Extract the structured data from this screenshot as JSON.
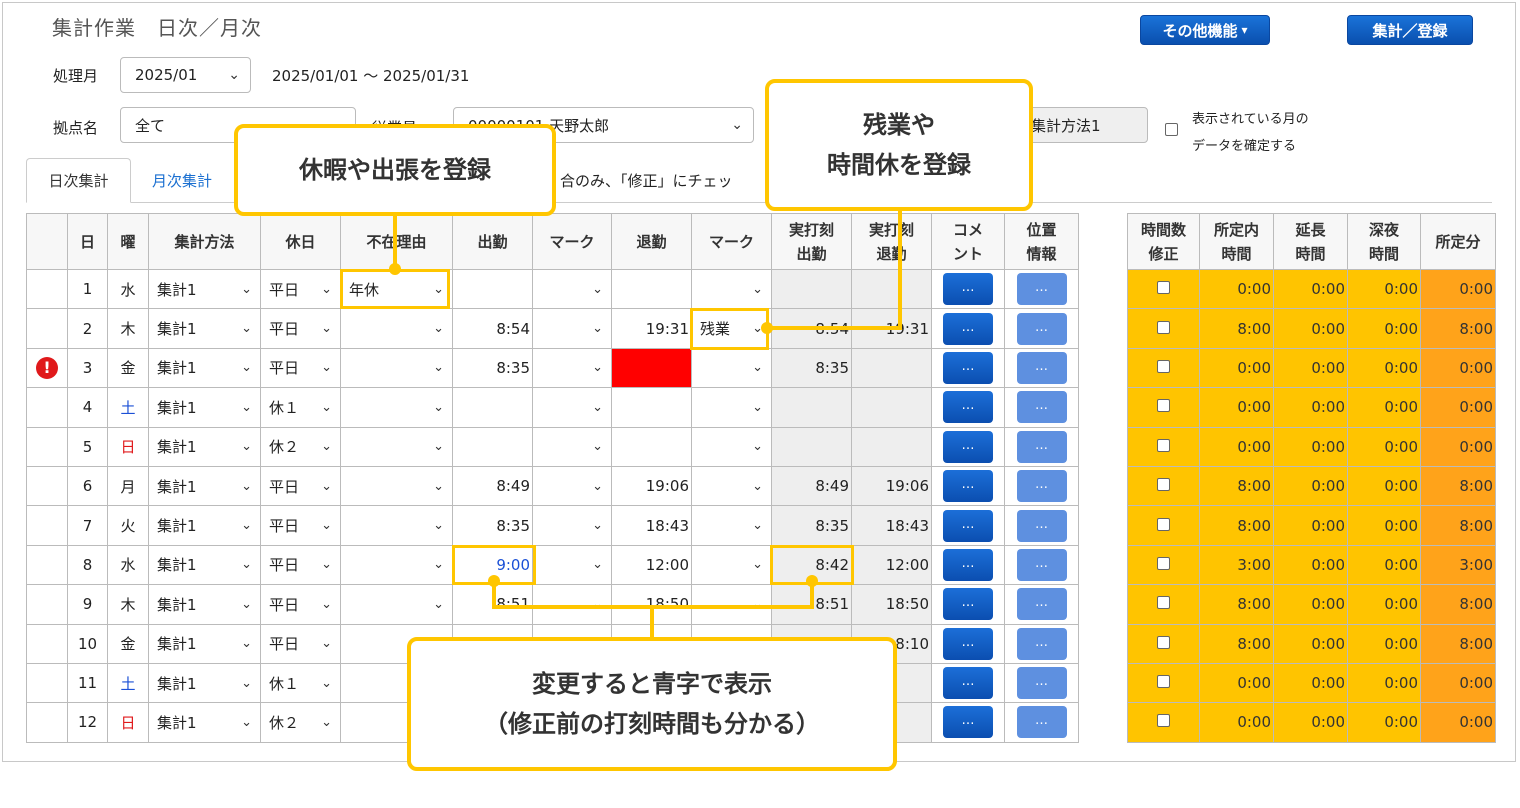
{
  "header": {
    "title": "集計作業　日次／月次",
    "other_functions": "その他機能",
    "other_functions_caret": "▾",
    "register": "集計／登録"
  },
  "filters": {
    "period_label": "処理月",
    "period_value": "2025/01",
    "period_range": "2025/01/01 〜 2025/01/31",
    "site_label": "拠点名",
    "site_value": "全て",
    "employee_label": "従業員",
    "employee_value": "00000101 天野太郎",
    "method_value": "集計方法1",
    "confirm_line1": "表示されている月の",
    "confirm_line2": "データを確定する"
  },
  "tabs": {
    "daily": "日次集計",
    "monthly": "月次集計"
  },
  "notice_text": "合のみ、「修正」にチェッ",
  "table_headers": {
    "day": "日",
    "weekday": "曜",
    "method": "集計方法",
    "holiday": "休日",
    "absence": "不在理由",
    "in": "出勤",
    "mark1": "マーク",
    "out": "退勤",
    "mark2": "マーク",
    "actual_in_1": "実打刻",
    "actual_in_2": "出勤",
    "actual_out_1": "実打刻",
    "actual_out_2": "退勤",
    "comment_1": "コメ",
    "comment_2": "ント",
    "location_1": "位置",
    "location_2": "情報"
  },
  "summary_headers": {
    "hours_fix_1": "時間数",
    "hours_fix_2": "修正",
    "scheduled_1": "所定内",
    "scheduled_2": "時間",
    "extended_1": "延長",
    "extended_2": "時間",
    "night_1": "深夜",
    "night_2": "時間",
    "scheduled_min": "所定分"
  },
  "dots_label": "…",
  "rows": [
    {
      "day": "1",
      "wd": "水",
      "wdc": "",
      "method": "集計1",
      "holiday": "平日",
      "absence": "年休",
      "in": "",
      "mark1": "",
      "out": "",
      "mark2": "",
      "ain": "",
      "aout": "",
      "s1": "0:00",
      "s2": "0:00",
      "s3": "0:00",
      "s4": "0:00"
    },
    {
      "day": "2",
      "wd": "木",
      "wdc": "",
      "method": "集計1",
      "holiday": "平日",
      "absence": "",
      "in": "8:54",
      "mark1": "",
      "out": "19:31",
      "mark2": "残業",
      "ain": "8:54",
      "aout": "19:31",
      "s1": "8:00",
      "s2": "0:00",
      "s3": "0:00",
      "s4": "8:00"
    },
    {
      "day": "3",
      "wd": "金",
      "wdc": "",
      "method": "集計1",
      "holiday": "平日",
      "absence": "",
      "in": "8:35",
      "mark1": "",
      "out": "",
      "mark2": "",
      "ain": "8:35",
      "aout": "",
      "s1": "0:00",
      "s2": "0:00",
      "s3": "0:00",
      "s4": "0:00"
    },
    {
      "day": "4",
      "wd": "土",
      "wdc": "blue",
      "method": "集計1",
      "holiday": "休１",
      "absence": "",
      "in": "",
      "mark1": "",
      "out": "",
      "mark2": "",
      "ain": "",
      "aout": "",
      "s1": "0:00",
      "s2": "0:00",
      "s3": "0:00",
      "s4": "0:00"
    },
    {
      "day": "5",
      "wd": "日",
      "wdc": "red",
      "method": "集計1",
      "holiday": "休２",
      "absence": "",
      "in": "",
      "mark1": "",
      "out": "",
      "mark2": "",
      "ain": "",
      "aout": "",
      "s1": "0:00",
      "s2": "0:00",
      "s3": "0:00",
      "s4": "0:00"
    },
    {
      "day": "6",
      "wd": "月",
      "wdc": "",
      "method": "集計1",
      "holiday": "平日",
      "absence": "",
      "in": "8:49",
      "mark1": "",
      "out": "19:06",
      "mark2": "",
      "ain": "8:49",
      "aout": "19:06",
      "s1": "8:00",
      "s2": "0:00",
      "s3": "0:00",
      "s4": "8:00"
    },
    {
      "day": "7",
      "wd": "火",
      "wdc": "",
      "method": "集計1",
      "holiday": "平日",
      "absence": "",
      "in": "8:35",
      "mark1": "",
      "out": "18:43",
      "mark2": "",
      "ain": "8:35",
      "aout": "18:43",
      "s1": "8:00",
      "s2": "0:00",
      "s3": "0:00",
      "s4": "8:00"
    },
    {
      "day": "8",
      "wd": "水",
      "wdc": "",
      "method": "集計1",
      "holiday": "平日",
      "absence": "",
      "in": "9:00",
      "mark1": "",
      "out": "12:00",
      "mark2": "",
      "ain": "8:42",
      "aout": "12:00",
      "s1": "3:00",
      "s2": "0:00",
      "s3": "0:00",
      "s4": "3:00"
    },
    {
      "day": "9",
      "wd": "木",
      "wdc": "",
      "method": "集計1",
      "holiday": "平日",
      "absence": "",
      "in": "8:51",
      "mark1": "",
      "out": "18:50",
      "mark2": "",
      "ain": "8:51",
      "aout": "18:50",
      "s1": "8:00",
      "s2": "0:00",
      "s3": "0:00",
      "s4": "8:00"
    },
    {
      "day": "10",
      "wd": "金",
      "wdc": "",
      "method": "集計1",
      "holiday": "平日",
      "absence": "",
      "in": "",
      "mark1": "",
      "out": "",
      "mark2": "",
      "ain": "",
      "aout": "18:10",
      "s1": "8:00",
      "s2": "0:00",
      "s3": "0:00",
      "s4": "8:00"
    },
    {
      "day": "11",
      "wd": "土",
      "wdc": "blue",
      "method": "集計1",
      "holiday": "休１",
      "absence": "",
      "in": "",
      "mark1": "",
      "out": "",
      "mark2": "",
      "ain": "",
      "aout": "",
      "s1": "0:00",
      "s2": "0:00",
      "s3": "0:00",
      "s4": "0:00"
    },
    {
      "day": "12",
      "wd": "日",
      "wdc": "red",
      "method": "集計1",
      "holiday": "休２",
      "absence": "",
      "in": "",
      "mark1": "",
      "out": "",
      "mark2": "",
      "ain": "",
      "aout": "",
      "s1": "0:00",
      "s2": "0:00",
      "s3": "0:00",
      "s4": "0:00"
    }
  ],
  "callouts": {
    "absence": "休暇や出張を登録",
    "overtime_1": "残業や",
    "overtime_2": "時間休を登録",
    "blue_1": "変更すると青字で表示",
    "blue_2": "（修正前の打刻時間も分かる）"
  },
  "colors": {
    "accent_blue": "#0a4fae",
    "highlight_yellow": "#ffc600",
    "summary_yellow": "#ffc400",
    "summary_orange": "#ffa31a",
    "error_red": "#ff0000"
  },
  "icons": {
    "warning": "exclamation-circle-icon",
    "chevron": "chevron-down-icon"
  }
}
